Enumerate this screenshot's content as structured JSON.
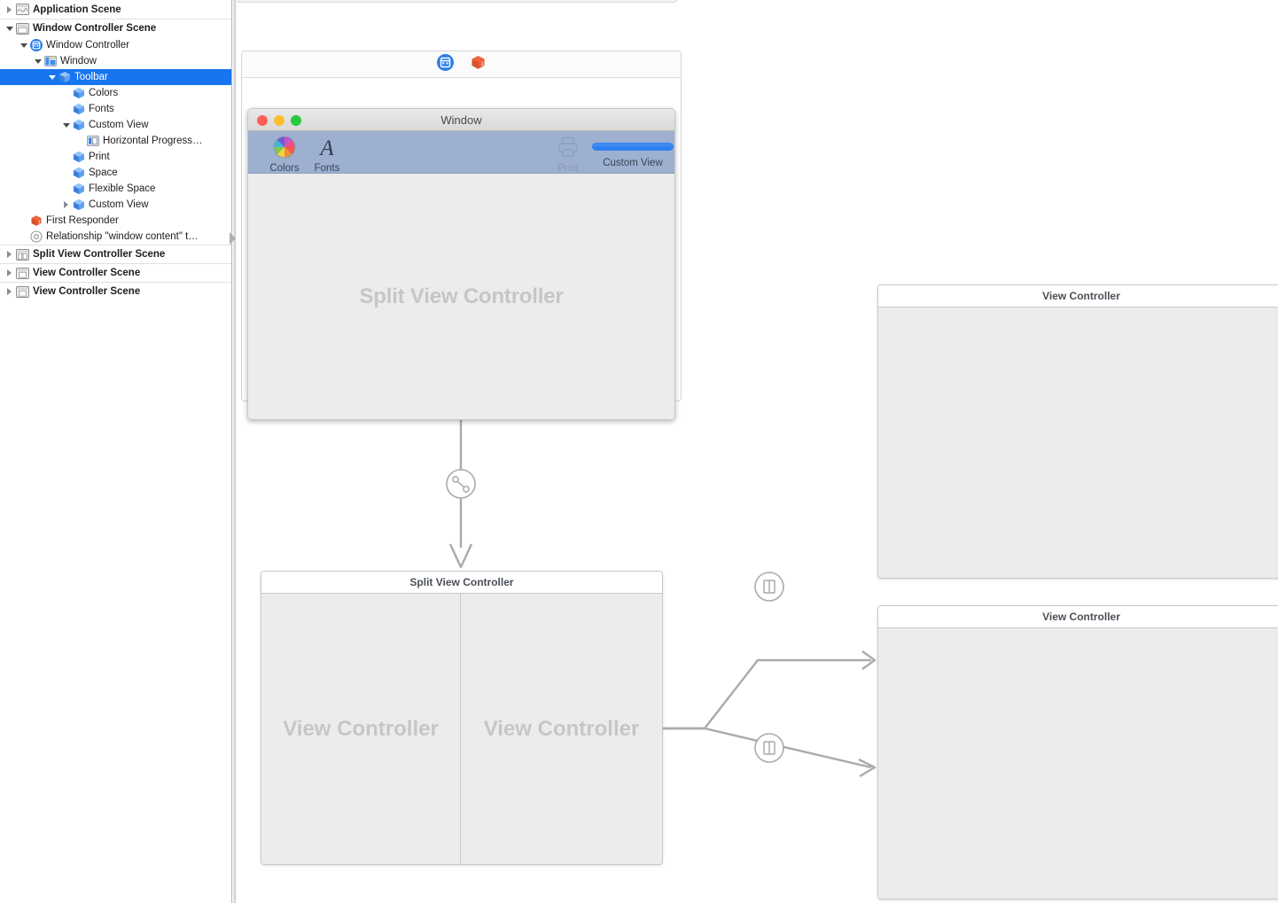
{
  "outline": {
    "rows": [
      {
        "label": "Application Scene",
        "icon": "scene-icon",
        "depth": 0,
        "twisty": "closed",
        "scene": true,
        "selected": false,
        "sep": false
      },
      {
        "label": "Window Controller Scene",
        "icon": "window-scene-icon",
        "depth": 0,
        "twisty": "open",
        "scene": true,
        "selected": false,
        "sep": true
      },
      {
        "label": "Window Controller",
        "icon": "window-controller-icon",
        "depth": 1,
        "twisty": "open",
        "scene": false,
        "selected": false,
        "sep": false
      },
      {
        "label": "Window",
        "icon": "window-icon",
        "depth": 2,
        "twisty": "open",
        "scene": false,
        "selected": false,
        "sep": false
      },
      {
        "label": "Toolbar",
        "icon": "cube-icon",
        "depth": 3,
        "twisty": "open",
        "scene": false,
        "selected": true,
        "sep": false
      },
      {
        "label": "Colors",
        "icon": "cube-icon",
        "depth": 4,
        "twisty": "none",
        "scene": false,
        "selected": false,
        "sep": false
      },
      {
        "label": "Fonts",
        "icon": "cube-icon",
        "depth": 4,
        "twisty": "none",
        "scene": false,
        "selected": false,
        "sep": false
      },
      {
        "label": "Custom View",
        "icon": "cube-icon",
        "depth": 4,
        "twisty": "open",
        "scene": false,
        "selected": false,
        "sep": false
      },
      {
        "label": "Horizontal Progress…",
        "icon": "progress-indicator-icon",
        "depth": 5,
        "twisty": "none",
        "scene": false,
        "selected": false,
        "sep": false
      },
      {
        "label": "Print",
        "icon": "cube-icon",
        "depth": 4,
        "twisty": "none",
        "scene": false,
        "selected": false,
        "sep": false
      },
      {
        "label": "Space",
        "icon": "cube-icon",
        "depth": 4,
        "twisty": "none",
        "scene": false,
        "selected": false,
        "sep": false
      },
      {
        "label": "Flexible Space",
        "icon": "cube-icon",
        "depth": 4,
        "twisty": "none",
        "scene": false,
        "selected": false,
        "sep": false
      },
      {
        "label": "Custom View",
        "icon": "cube-icon",
        "depth": 4,
        "twisty": "closed",
        "scene": false,
        "selected": false,
        "sep": false
      },
      {
        "label": "First Responder",
        "icon": "first-responder-icon",
        "depth": 1,
        "twisty": "none",
        "scene": false,
        "selected": false,
        "sep": false
      },
      {
        "label": "Relationship \"window content\" t…",
        "icon": "relationship-segue-icon",
        "depth": 1,
        "twisty": "none",
        "scene": false,
        "selected": false,
        "sep": false
      },
      {
        "label": "Split View Controller Scene",
        "icon": "split-view-scene-icon",
        "depth": 0,
        "twisty": "closed",
        "scene": true,
        "selected": false,
        "sep": true
      },
      {
        "label": "View Controller Scene",
        "icon": "view-controller-scene-icon",
        "depth": 0,
        "twisty": "closed",
        "scene": true,
        "selected": false,
        "sep": true
      },
      {
        "label": "View Controller Scene",
        "icon": "view-controller-scene-icon",
        "depth": 0,
        "twisty": "closed",
        "scene": true,
        "selected": false,
        "sep": true
      }
    ]
  },
  "canvas": {
    "window_controller_scene": {
      "dock_icons": [
        "window-controller-dock-icon",
        "first-responder-dock-icon"
      ],
      "window": {
        "title": "Window",
        "traffic_lights": [
          "#ff5f57",
          "#febc2e",
          "#28c840"
        ],
        "toolbar": {
          "items": [
            {
              "label": "Colors",
              "icon": "color-wheel-icon",
              "dim": false
            },
            {
              "label": "Fonts",
              "icon": "fonts-a-icon",
              "dim": false
            },
            {
              "label": "Print",
              "icon": "printer-icon",
              "dim": true
            },
            {
              "label": "Custom View",
              "icon": "progress-bar-icon",
              "dim": false
            }
          ]
        },
        "content_placeholder": "Split View Controller"
      }
    },
    "split_view_controller_scene": {
      "title": "Split View Controller",
      "panes": [
        {
          "placeholder": "View Controller"
        },
        {
          "placeholder": "View Controller"
        }
      ]
    },
    "view_controller_scene_1": {
      "title": "View Controller"
    },
    "view_controller_scene_2": {
      "title": "View Controller"
    },
    "segues": [
      {
        "name": "window-content-relationship-segue",
        "badge": "link-badge-icon"
      },
      {
        "name": "split-view-relationship-segue-top",
        "badge": "split-view-badge-icon"
      },
      {
        "name": "split-view-relationship-segue-bottom",
        "badge": "split-view-badge-icon"
      }
    ]
  },
  "colors": {
    "selection": "#1875f0",
    "cube": "#3b8cf0",
    "toolbar_bg": "#9db0d0",
    "placeholder_text": "#c6c6c6",
    "connection_line": "#aaaaaa",
    "progress_bar": "#2d7ff0"
  }
}
